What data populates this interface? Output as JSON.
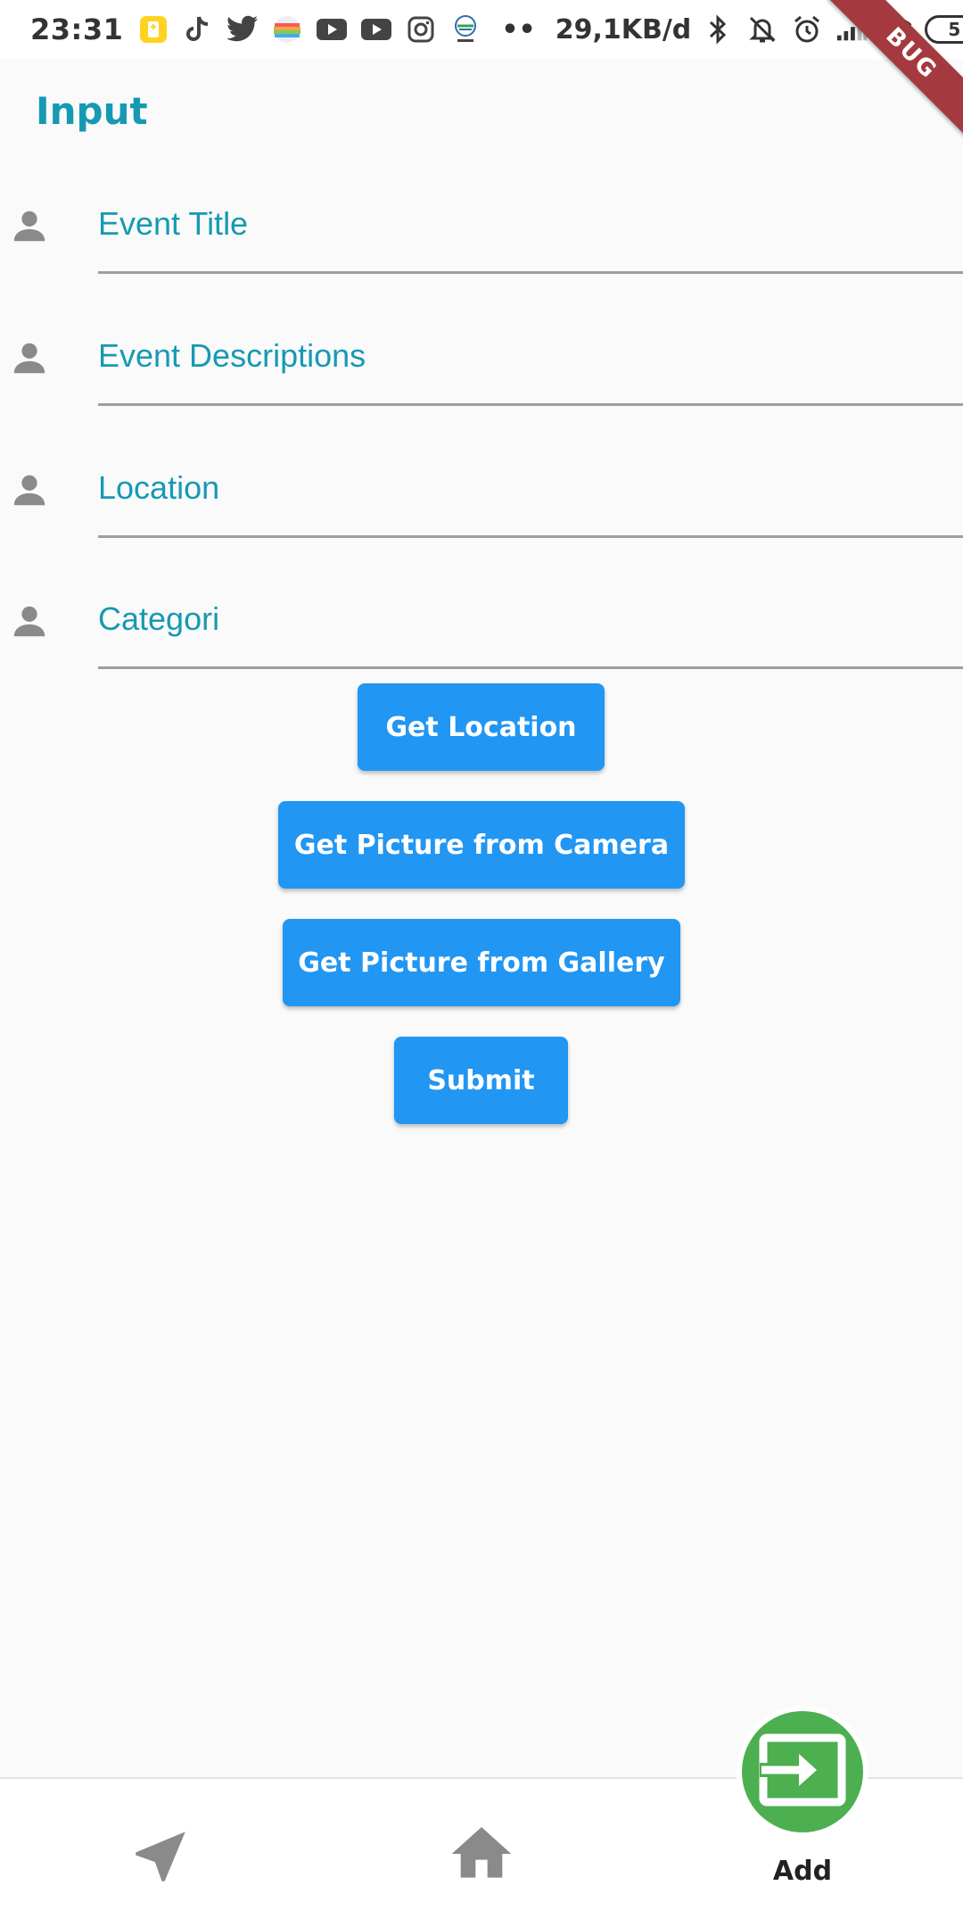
{
  "status_bar": {
    "time": "23:31",
    "network_speed": "29,1KB/d",
    "overflow_dots": "••",
    "battery_level": "5",
    "icons": [
      "battery-saver-icon",
      "tiktok-icon",
      "twitter-icon",
      "rainbow-app-icon",
      "youtube-icon",
      "youtube-icon",
      "instagram-icon",
      "bmkg-icon",
      "bluetooth-icon",
      "mute-icon",
      "alarm-icon",
      "signal-icon",
      "wifi-icon"
    ]
  },
  "debug_banner": "BUG",
  "page": {
    "title": "Input"
  },
  "form": {
    "fields": [
      {
        "label": "Event Title",
        "icon": "person-icon"
      },
      {
        "label": "Event Descriptions",
        "icon": "person-icon"
      },
      {
        "label": "Location",
        "icon": "person-icon"
      },
      {
        "label": "Categori",
        "icon": "person-icon"
      }
    ],
    "buttons": {
      "get_location": "Get Location",
      "camera": "Get Picture from Camera",
      "gallery": "Get Picture from Gallery",
      "submit": "Submit"
    }
  },
  "bottom_nav": {
    "items": [
      {
        "icon": "navigation-arrow-icon",
        "label": ""
      },
      {
        "icon": "home-icon",
        "label": ""
      },
      {
        "icon": "input-icon",
        "label": "Add"
      }
    ],
    "active_color": "#4caf50"
  },
  "colors": {
    "accent": "#1699b3",
    "button": "#2196f3",
    "fab": "#4caf50",
    "icon_grey": "#8a8a8a"
  }
}
